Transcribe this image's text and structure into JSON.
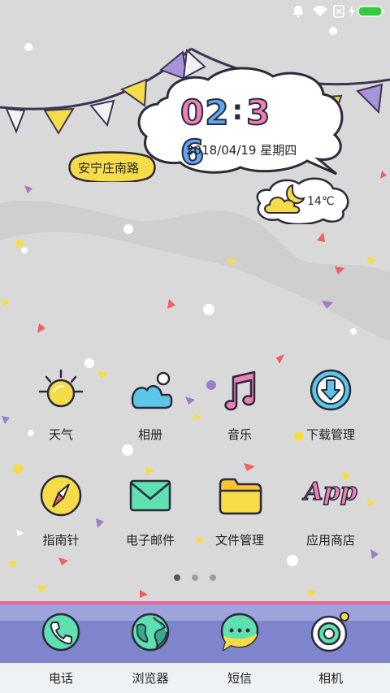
{
  "status_bar": {
    "icons": [
      "bell-icon",
      "wifi-icon",
      "sim-x-icon",
      "charging-icon",
      "battery-icon"
    ],
    "battery_color": "#2ecc40"
  },
  "clock": {
    "hour_1": "0",
    "hour_2": "2",
    "minute_1": "3",
    "minute_2": "6",
    "date": "2018/04/19 星期四"
  },
  "location": "安宁庄南路",
  "weather": {
    "temperature": "14℃",
    "icon": "partly-cloudy-moon-icon"
  },
  "apps": [
    {
      "label": "天气",
      "icon": "sun-icon"
    },
    {
      "label": "相册",
      "icon": "photo-album-icon"
    },
    {
      "label": "音乐",
      "icon": "music-note-icon"
    },
    {
      "label": "下载管理",
      "icon": "download-icon"
    },
    {
      "label": "指南针",
      "icon": "compass-icon"
    },
    {
      "label": "电子邮件",
      "icon": "envelope-icon"
    },
    {
      "label": "文件管理",
      "icon": "folder-icon"
    },
    {
      "label": "应用商店",
      "icon": "app-store-icon",
      "badge_text": "App"
    }
  ],
  "page_indicator": {
    "total": 3,
    "current": 1
  },
  "dock": [
    {
      "label": "电话",
      "icon": "phone-icon"
    },
    {
      "label": "浏览器",
      "icon": "globe-icon"
    },
    {
      "label": "短信",
      "icon": "message-bubble-icon"
    },
    {
      "label": "相机",
      "icon": "camera-icon"
    }
  ],
  "colors": {
    "background": "#d9d9d9",
    "pink": "#f07fb8",
    "blue": "#5fa8f5",
    "yellow": "#f7dc4a",
    "purple": "#7e85cc"
  }
}
